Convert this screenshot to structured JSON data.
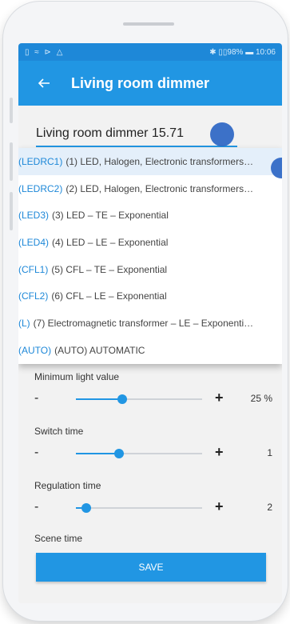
{
  "status_bar": {
    "left_icons": "▯ ≈ ⊳ △",
    "right_text": "✱ ▯▯98% ▬ 10:06"
  },
  "toolbar": {
    "title": "Living room dimmer",
    "back_icon": "arrow-left-icon"
  },
  "name_field": {
    "value": "Living room dimmer 15.71"
  },
  "dropdown": {
    "items": [
      {
        "code": "(LEDRC1)",
        "text": "(1) LED, Halogen, Electronic transformers…",
        "selected": true
      },
      {
        "code": "(LEDRC2)",
        "text": "(2) LED, Halogen, Electronic transformers…",
        "selected": false
      },
      {
        "code": "(LED3)",
        "text": "(3) LED – TE – Exponential",
        "selected": false
      },
      {
        "code": "(LED4)",
        "text": "(4) LED – LE – Exponential",
        "selected": false
      },
      {
        "code": "(CFL1)",
        "text": "(5) CFL – TE – Exponential",
        "selected": false
      },
      {
        "code": "(CFL2)",
        "text": "(6) CFL – LE – Exponential",
        "selected": false
      },
      {
        "code": "(L)",
        "text": "(7) Electromagnetic transformer – LE – Exponenti…",
        "selected": false
      },
      {
        "code": "(AUTO)",
        "text": "(AUTO) AUTOMATIC",
        "selected": false
      }
    ]
  },
  "settings": [
    {
      "label": "Minimum light value",
      "minus": "-",
      "plus": "+",
      "value": "25 %",
      "fraction": 0.37
    },
    {
      "label": "Switch time",
      "minus": "-",
      "plus": "+",
      "value": "1",
      "fraction": 0.34
    },
    {
      "label": "Regulation time",
      "minus": "-",
      "plus": "+",
      "value": "2",
      "fraction": 0.08
    },
    {
      "label": "Scene time"
    }
  ],
  "save_button": {
    "label": "SAVE"
  },
  "colors": {
    "accent": "#2196e3",
    "statusbar": "#1e88d8",
    "code_text": "#1e88d8"
  }
}
